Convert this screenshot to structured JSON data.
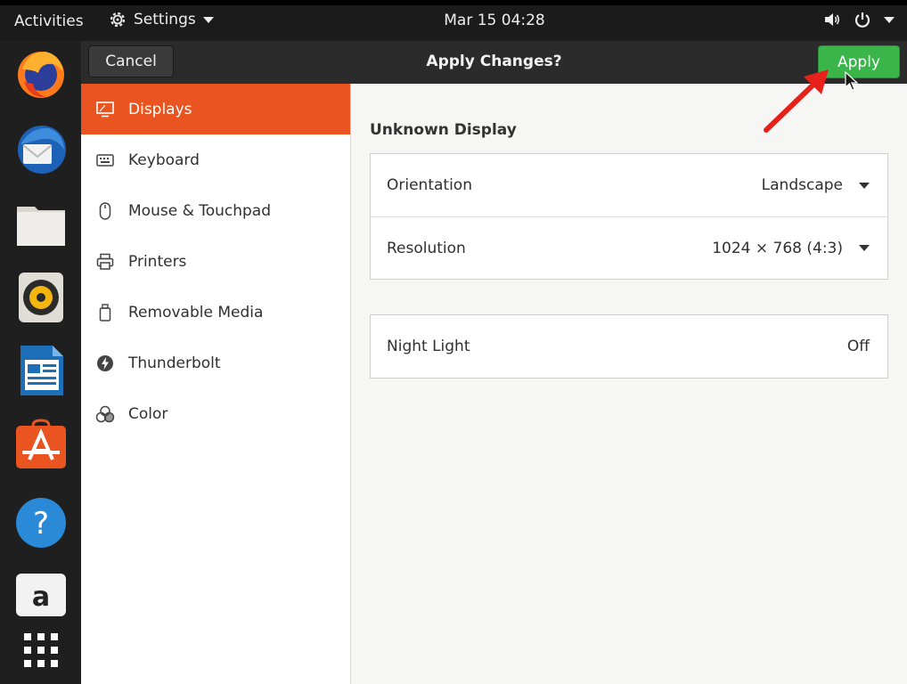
{
  "topbar": {
    "activities": "Activities",
    "app_menu_label": "Settings",
    "clock": "Mar 15  04:28"
  },
  "dock": {
    "apps": [
      "firefox",
      "thunderbird",
      "files",
      "rhythmbox",
      "libreoffice-writer",
      "software-center",
      "help",
      "amazon",
      "show-applications"
    ]
  },
  "headerbar": {
    "cancel_label": "Cancel",
    "title": "Apply Changes?",
    "apply_label": "Apply"
  },
  "sidebar": {
    "items": [
      {
        "label": "Displays",
        "icon": "display-icon"
      },
      {
        "label": "Keyboard",
        "icon": "keyboard-icon"
      },
      {
        "label": "Mouse & Touchpad",
        "icon": "mouse-icon"
      },
      {
        "label": "Printers",
        "icon": "printer-icon"
      },
      {
        "label": "Removable Media",
        "icon": "usb-drive-icon"
      },
      {
        "label": "Thunderbolt",
        "icon": "thunderbolt-icon"
      },
      {
        "label": "Color",
        "icon": "color-icon"
      }
    ]
  },
  "display": {
    "name": "Unknown Display",
    "orientation_label": "Orientation",
    "orientation_value": "Landscape",
    "resolution_label": "Resolution",
    "resolution_value": "1024 × 768 (4:3)",
    "night_light_label": "Night Light",
    "night_light_value": "Off"
  },
  "colors": {
    "accent": "#e95420",
    "apply": "#3ab54a",
    "annotation_arrow": "#e8201a"
  }
}
